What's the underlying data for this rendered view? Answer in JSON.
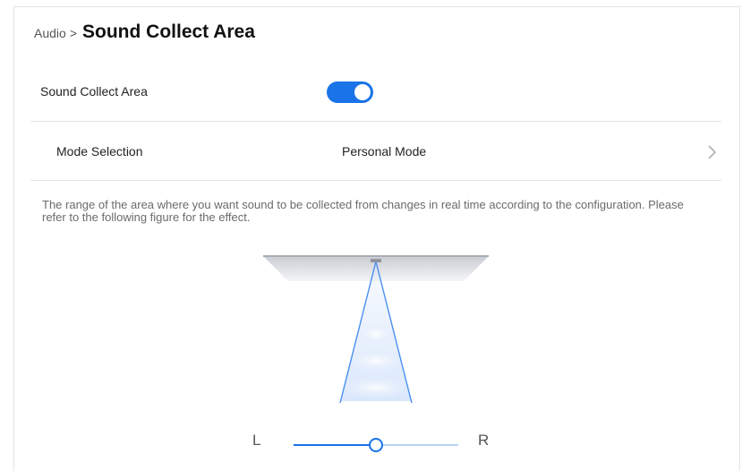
{
  "breadcrumb": {
    "parent": "Audio",
    "separator": ">",
    "current": "Sound Collect Area"
  },
  "settings": {
    "sound_collect": {
      "label": "Sound Collect Area",
      "enabled": true
    },
    "mode": {
      "label": "Mode Selection",
      "value": "Personal Mode"
    }
  },
  "description": "The range of the area where you want sound to be collected from changes in real time according to the configuration. Please refer to the following figure for the effect.",
  "slider": {
    "left_label": "L",
    "right_label": "R",
    "value": 0.5
  },
  "colors": {
    "accent": "#1a73e8",
    "track_light": "#b9d3f7",
    "text_muted": "#6b6b6b"
  }
}
